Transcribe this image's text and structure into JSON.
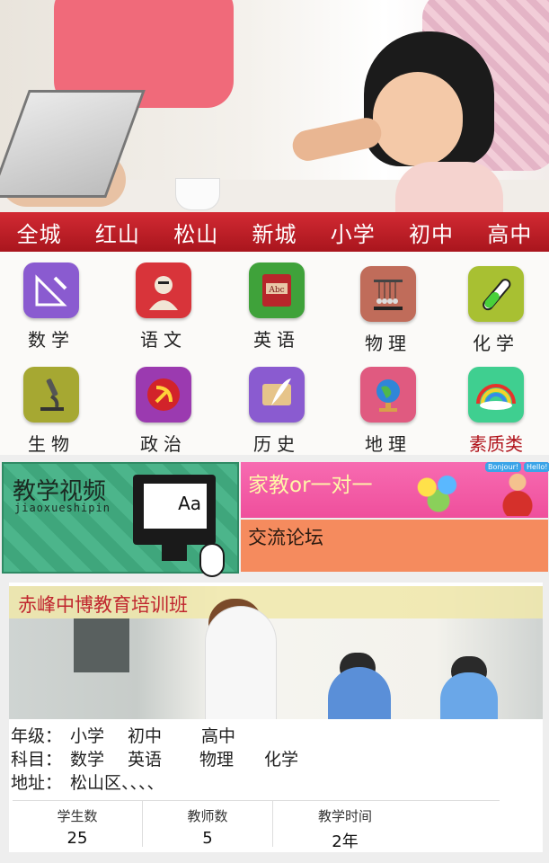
{
  "nav": [
    "全城",
    "红山",
    "松山",
    "新城",
    "小学",
    "初中",
    "高中"
  ],
  "subjects": [
    {
      "label": "数学",
      "icon": "ruler-protractor-icon",
      "color": "#8a5bd0"
    },
    {
      "label": "语文",
      "icon": "scholar-portrait-icon",
      "color": "#d8343a"
    },
    {
      "label": "英语",
      "icon": "abc-book-icon",
      "color": "#3fa23a"
    },
    {
      "label": "物理",
      "icon": "newtons-cradle-icon",
      "color": "#c06c5a"
    },
    {
      "label": "化学",
      "icon": "test-tube-icon",
      "color": "#a8c032"
    },
    {
      "label": "生物",
      "icon": "microscope-icon",
      "color": "#a6a832"
    },
    {
      "label": "政治",
      "icon": "hammer-sickle-icon",
      "color": "#9b3ab0"
    },
    {
      "label": "历史",
      "icon": "scroll-quill-icon",
      "color": "#8a5bd0"
    },
    {
      "label": "地理",
      "icon": "globe-icon",
      "color": "#e05a80"
    },
    {
      "label": "素质类",
      "icon": "rainbow-icon",
      "color": "#3fcf90"
    }
  ],
  "features": {
    "video_title": "教学视频",
    "video_sub": "jiaoxueshipin",
    "board_text": "Aa",
    "tutor_title": "家教or一对一",
    "bubble_1": "Bonjour!",
    "bubble_2": "Hello!",
    "forum_title": "交流论坛"
  },
  "school": {
    "name": "赤峰中博教育培训班",
    "grade_label": "年级：",
    "grades": [
      "小学",
      "初中",
      "高中"
    ],
    "subject_label": "科目：",
    "subjects": [
      "数学",
      "英语",
      "物理",
      "化学"
    ],
    "address_label": "地址：",
    "address": "松山区、、、、",
    "stats": [
      {
        "label": "学生数",
        "value": "25"
      },
      {
        "label": "教师数",
        "value": "5"
      },
      {
        "label": "教学时间",
        "value": "2年"
      }
    ]
  }
}
